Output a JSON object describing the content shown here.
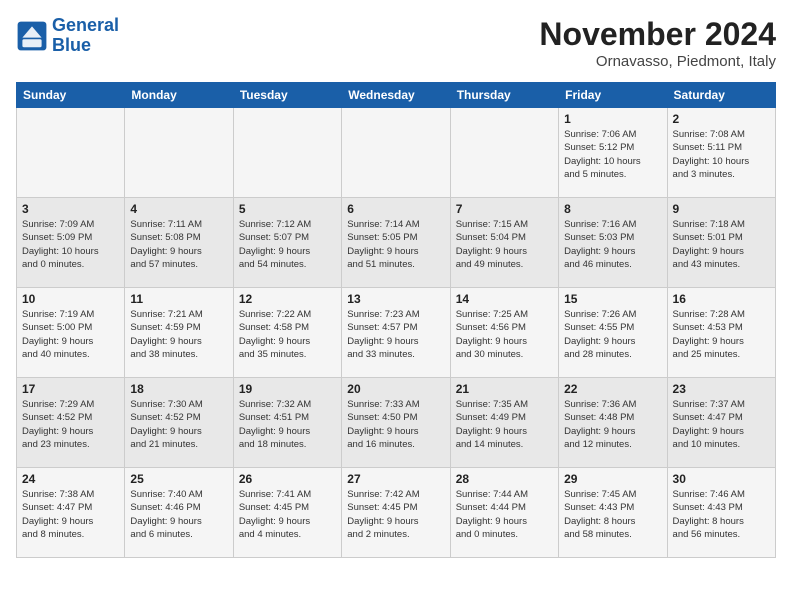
{
  "header": {
    "logo_line1": "General",
    "logo_line2": "Blue",
    "month": "November 2024",
    "location": "Ornavasso, Piedmont, Italy"
  },
  "weekdays": [
    "Sunday",
    "Monday",
    "Tuesday",
    "Wednesday",
    "Thursday",
    "Friday",
    "Saturday"
  ],
  "weeks": [
    [
      {
        "day": "",
        "content": ""
      },
      {
        "day": "",
        "content": ""
      },
      {
        "day": "",
        "content": ""
      },
      {
        "day": "",
        "content": ""
      },
      {
        "day": "",
        "content": ""
      },
      {
        "day": "1",
        "content": "Sunrise: 7:06 AM\nSunset: 5:12 PM\nDaylight: 10 hours\nand 5 minutes."
      },
      {
        "day": "2",
        "content": "Sunrise: 7:08 AM\nSunset: 5:11 PM\nDaylight: 10 hours\nand 3 minutes."
      }
    ],
    [
      {
        "day": "3",
        "content": "Sunrise: 7:09 AM\nSunset: 5:09 PM\nDaylight: 10 hours\nand 0 minutes."
      },
      {
        "day": "4",
        "content": "Sunrise: 7:11 AM\nSunset: 5:08 PM\nDaylight: 9 hours\nand 57 minutes."
      },
      {
        "day": "5",
        "content": "Sunrise: 7:12 AM\nSunset: 5:07 PM\nDaylight: 9 hours\nand 54 minutes."
      },
      {
        "day": "6",
        "content": "Sunrise: 7:14 AM\nSunset: 5:05 PM\nDaylight: 9 hours\nand 51 minutes."
      },
      {
        "day": "7",
        "content": "Sunrise: 7:15 AM\nSunset: 5:04 PM\nDaylight: 9 hours\nand 49 minutes."
      },
      {
        "day": "8",
        "content": "Sunrise: 7:16 AM\nSunset: 5:03 PM\nDaylight: 9 hours\nand 46 minutes."
      },
      {
        "day": "9",
        "content": "Sunrise: 7:18 AM\nSunset: 5:01 PM\nDaylight: 9 hours\nand 43 minutes."
      }
    ],
    [
      {
        "day": "10",
        "content": "Sunrise: 7:19 AM\nSunset: 5:00 PM\nDaylight: 9 hours\nand 40 minutes."
      },
      {
        "day": "11",
        "content": "Sunrise: 7:21 AM\nSunset: 4:59 PM\nDaylight: 9 hours\nand 38 minutes."
      },
      {
        "day": "12",
        "content": "Sunrise: 7:22 AM\nSunset: 4:58 PM\nDaylight: 9 hours\nand 35 minutes."
      },
      {
        "day": "13",
        "content": "Sunrise: 7:23 AM\nSunset: 4:57 PM\nDaylight: 9 hours\nand 33 minutes."
      },
      {
        "day": "14",
        "content": "Sunrise: 7:25 AM\nSunset: 4:56 PM\nDaylight: 9 hours\nand 30 minutes."
      },
      {
        "day": "15",
        "content": "Sunrise: 7:26 AM\nSunset: 4:55 PM\nDaylight: 9 hours\nand 28 minutes."
      },
      {
        "day": "16",
        "content": "Sunrise: 7:28 AM\nSunset: 4:53 PM\nDaylight: 9 hours\nand 25 minutes."
      }
    ],
    [
      {
        "day": "17",
        "content": "Sunrise: 7:29 AM\nSunset: 4:52 PM\nDaylight: 9 hours\nand 23 minutes."
      },
      {
        "day": "18",
        "content": "Sunrise: 7:30 AM\nSunset: 4:52 PM\nDaylight: 9 hours\nand 21 minutes."
      },
      {
        "day": "19",
        "content": "Sunrise: 7:32 AM\nSunset: 4:51 PM\nDaylight: 9 hours\nand 18 minutes."
      },
      {
        "day": "20",
        "content": "Sunrise: 7:33 AM\nSunset: 4:50 PM\nDaylight: 9 hours\nand 16 minutes."
      },
      {
        "day": "21",
        "content": "Sunrise: 7:35 AM\nSunset: 4:49 PM\nDaylight: 9 hours\nand 14 minutes."
      },
      {
        "day": "22",
        "content": "Sunrise: 7:36 AM\nSunset: 4:48 PM\nDaylight: 9 hours\nand 12 minutes."
      },
      {
        "day": "23",
        "content": "Sunrise: 7:37 AM\nSunset: 4:47 PM\nDaylight: 9 hours\nand 10 minutes."
      }
    ],
    [
      {
        "day": "24",
        "content": "Sunrise: 7:38 AM\nSunset: 4:47 PM\nDaylight: 9 hours\nand 8 minutes."
      },
      {
        "day": "25",
        "content": "Sunrise: 7:40 AM\nSunset: 4:46 PM\nDaylight: 9 hours\nand 6 minutes."
      },
      {
        "day": "26",
        "content": "Sunrise: 7:41 AM\nSunset: 4:45 PM\nDaylight: 9 hours\nand 4 minutes."
      },
      {
        "day": "27",
        "content": "Sunrise: 7:42 AM\nSunset: 4:45 PM\nDaylight: 9 hours\nand 2 minutes."
      },
      {
        "day": "28",
        "content": "Sunrise: 7:44 AM\nSunset: 4:44 PM\nDaylight: 9 hours\nand 0 minutes."
      },
      {
        "day": "29",
        "content": "Sunrise: 7:45 AM\nSunset: 4:43 PM\nDaylight: 8 hours\nand 58 minutes."
      },
      {
        "day": "30",
        "content": "Sunrise: 7:46 AM\nSunset: 4:43 PM\nDaylight: 8 hours\nand 56 minutes."
      }
    ]
  ]
}
